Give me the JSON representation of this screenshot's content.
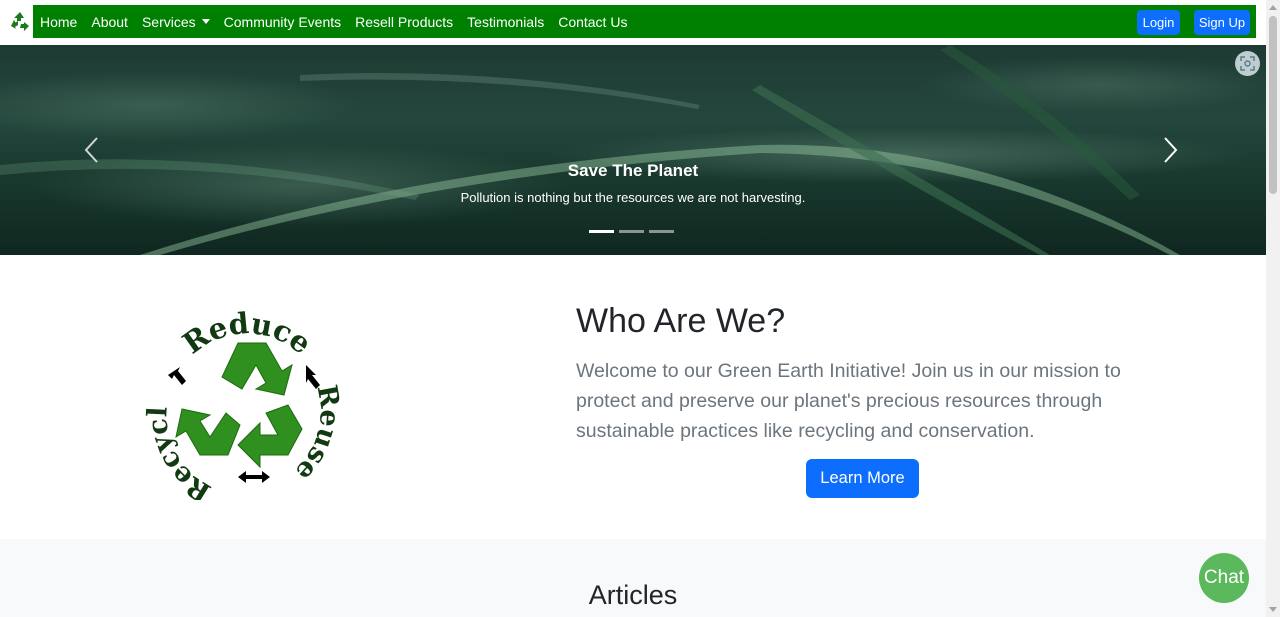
{
  "nav": {
    "logo_icon": "recycle-icon",
    "links": [
      "Home",
      "About",
      "Services",
      "Community Events",
      "Resell Products",
      "Testimonials",
      "Contact Us"
    ],
    "login_label": "Login",
    "signup_label": "Sign Up",
    "bar_color": "#008000",
    "button_color": "#0d6efd"
  },
  "carousel": {
    "title": "Save The Planet",
    "text": "Pollution is nothing but the resources we are not harvesting.",
    "slide_count": 3,
    "active_slide": 1,
    "prev_icon": "chevron-left-icon",
    "next_icon": "chevron-right-icon",
    "overlay_icon": "screen-capture-icon"
  },
  "about": {
    "logo_words": [
      "Reduce",
      "Reuse",
      "Recycle"
    ],
    "title": "Who Are We?",
    "text": "Welcome to our Green Earth Initiative! Join us in our mission to protect and preserve our planet's precious resources through sustainable practices like recycling and conservation.",
    "button_label": "Learn More"
  },
  "articles": {
    "title": "Articles"
  },
  "chat": {
    "label": "Chat",
    "color": "#5cb85c"
  }
}
